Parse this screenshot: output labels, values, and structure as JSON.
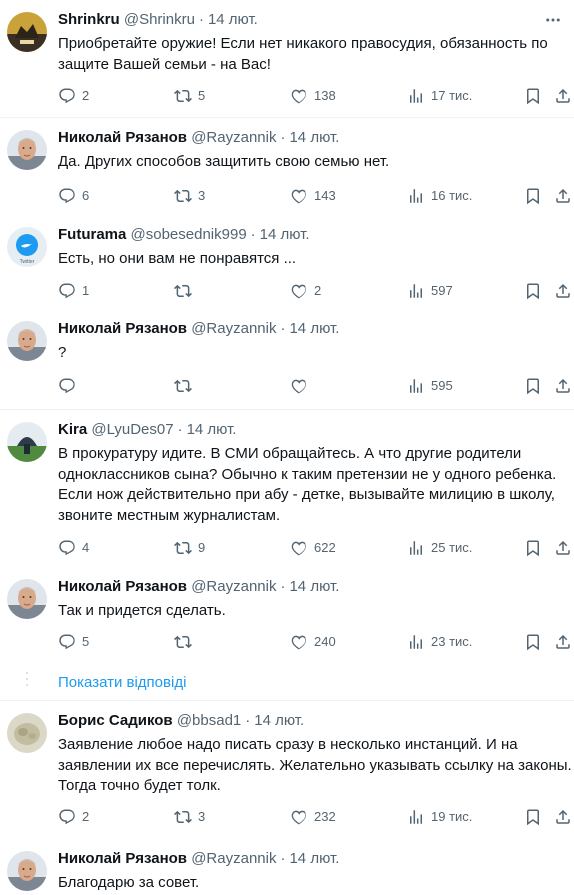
{
  "colors": {
    "link": "#1d9bf0",
    "muted": "#536471",
    "text": "#0f1419",
    "divider": "#eff3f4"
  },
  "tweets": [
    {
      "name": "Shrinkru",
      "handle": "@Shrinkru",
      "sep": "·",
      "date": "14 лют.",
      "lines": [
        "Приобретайте оружие! Если нет никакого правосудия, обязанность по",
        "защите Вашей семьи - на Вас!"
      ],
      "replies": "2",
      "retweets": "5",
      "likes": "138",
      "views": "17 тис."
    },
    {
      "name": "Николай Рязанов",
      "handle": "@Rayzannik",
      "sep": "·",
      "date": "14 лют.",
      "lines": [
        "Да. Других способов защитить свою семью нет."
      ],
      "replies": "6",
      "retweets": "3",
      "likes": "143",
      "views": "16 тис."
    },
    {
      "name": "Futurama",
      "handle": "@sobesednik999",
      "sep": "·",
      "date": "14 лют.",
      "lines": [
        "Есть, но они вам не понравятся ..."
      ],
      "replies": "1",
      "retweets": "",
      "likes": "2",
      "views": "597",
      "avatar_caption": "Twitter"
    },
    {
      "name": "Николай Рязанов",
      "handle": "@Rayzannik",
      "sep": "·",
      "date": "14 лют.",
      "lines": [
        "?"
      ],
      "replies": "",
      "retweets": "",
      "likes": "",
      "views": "595"
    },
    {
      "name": "Kira",
      "handle": "@LyuDes07",
      "sep": "·",
      "date": "14 лют.",
      "lines": [
        "В прокуратуру идите. В СМИ обращайтесь. А что другие родители",
        "одноклассников сына? Обычно к таким претензии не у одного ребенка.",
        "Если нож действительно при абу - детке, вызывайте милицию в школу,",
        "звоните местным журналистам."
      ],
      "replies": "4",
      "retweets": "9",
      "likes": "622",
      "views": "25 тис."
    },
    {
      "name": "Николай Рязанов",
      "handle": "@Rayzannik",
      "sep": "·",
      "date": "14 лют.",
      "lines": [
        "Так и придется сделать."
      ],
      "replies": "5",
      "retweets": "",
      "likes": "240",
      "views": "23 тис."
    },
    {
      "name": "Борис Садиков",
      "handle": "@bbsad1",
      "sep": "·",
      "date": "14 лют.",
      "lines": [
        "Заявление любое надо писать сразу в несколько инстанций. И на",
        "заявлении их все перечислять. Желательно указывать ссылку на законы.",
        "Тогда точно будет толк."
      ],
      "replies": "2",
      "retweets": "3",
      "likes": "232",
      "views": "19 тис."
    },
    {
      "name": "Николай Рязанов",
      "handle": "@Rayzannik",
      "sep": "·",
      "date": "14 лют.",
      "lines": [
        "Благодарю за совет."
      ],
      "replies": "",
      "retweets": "",
      "likes": "",
      "views": ""
    }
  ],
  "show_replies_label": "Показати відповіді"
}
